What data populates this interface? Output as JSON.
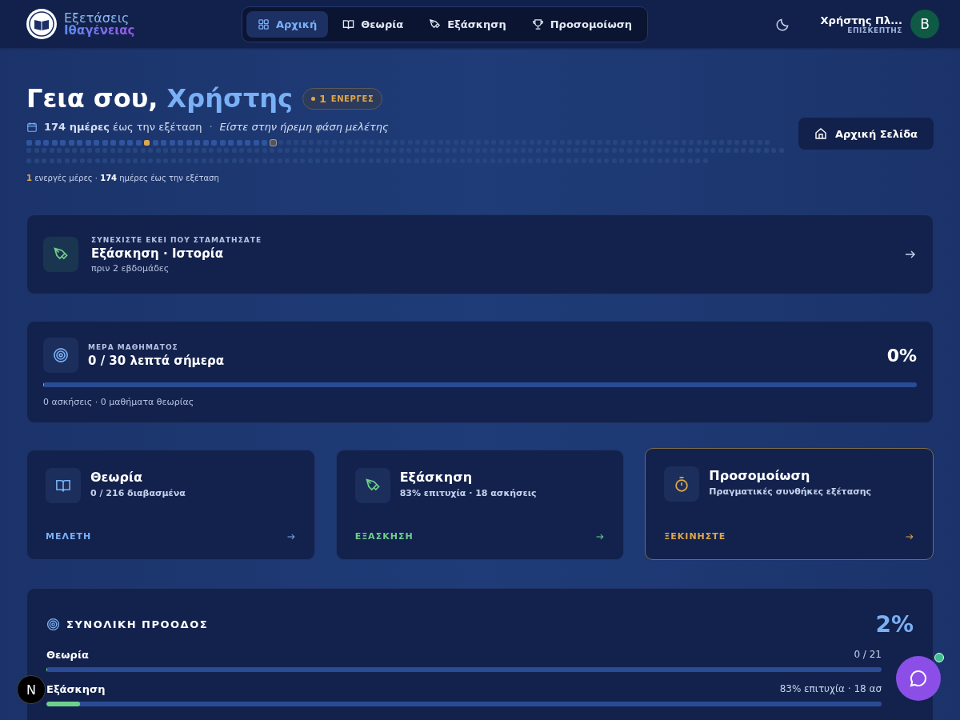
{
  "brand": {
    "line1": "Εξετάσεις",
    "line2": "Ιθαγένειας"
  },
  "nav": [
    {
      "label": "Αρχική",
      "selected": true
    },
    {
      "label": "Θεωρία",
      "selected": false
    },
    {
      "label": "Εξάσκηση",
      "selected": false
    },
    {
      "label": "Προσομοίωση",
      "selected": false
    }
  ],
  "user": {
    "name": "Χρήστης Πλ...",
    "role": "ΕΠΙΣΚΕΠΤΗΣ",
    "initial": "B"
  },
  "greeting": {
    "hello": "Γεια σου,",
    "name": "Χρήστης",
    "badge_count": "1",
    "badge_label": "ΕΝΕΡΓΕΣ",
    "countdown": "**174 ημέρες** έως την εξέταση",
    "separator": "·",
    "phase": "Είστε στην ήρεμη φάση μελέτης",
    "summary": "**1** ενεργές μέρες · **174** ημέρες έως την εξέταση"
  },
  "days": [
    {
      "kind": "past"
    },
    {
      "kind": "past"
    },
    {
      "kind": "past"
    },
    {
      "kind": "past"
    },
    {
      "kind": "past"
    },
    {
      "kind": "past"
    },
    {
      "kind": "past"
    },
    {
      "kind": "past"
    },
    {
      "kind": "past"
    },
    {
      "kind": "past"
    },
    {
      "kind": "past"
    },
    {
      "kind": "past"
    },
    {
      "kind": "past"
    },
    {
      "kind": "past"
    },
    {
      "kind": "active"
    },
    {
      "kind": "past"
    },
    {
      "kind": "past"
    },
    {
      "kind": "past"
    },
    {
      "kind": "past"
    },
    {
      "kind": "past"
    },
    {
      "kind": "past"
    },
    {
      "kind": "past"
    },
    {
      "kind": "past"
    },
    {
      "kind": "past"
    },
    {
      "kind": "past"
    },
    {
      "kind": "past"
    },
    {
      "kind": "past"
    },
    {
      "kind": "past"
    },
    {
      "kind": "past"
    },
    {
      "kind": "today"
    }
  ],
  "home_button": "Αρχική Σελίδα",
  "resume": {
    "label": "ΣΥΝΕΧΙΣΤΕ ΕΚΕΙ ΠΟΥ ΣΤΑΜΑΤΗΣΑΤΕ",
    "title": "Εξάσκηση · Ιστορία",
    "time": "πριν 2 εβδομάδες"
  },
  "daily": {
    "label": "ΜΕΡΑ ΜΑΘΗΜΑΤΟΣ",
    "title": "0 / 30 λεπτά σήμερα",
    "percent": "0%",
    "level": 0,
    "detail": "0 ασκήσεις · 0 μαθήματα θεωρίας"
  },
  "modes": [
    {
      "kind": "theory",
      "title": "Θεωρία",
      "subtitle": "0 / 216 διαβασμένα",
      "action": "ΜΕΛΕΤΗ",
      "color": "#7ab0f5",
      "highlighted": false
    },
    {
      "kind": "practice",
      "title": "Εξάσκηση",
      "subtitle": "83% επιτυχία · 18 ασκήσεις",
      "action": "ΕΞΑΣΚΗΣΗ",
      "color": "#6fd08c",
      "highlighted": false
    },
    {
      "kind": "exam",
      "title": "Προσομοίωση",
      "subtitle": "Πραγματικές συνθήκες εξέτασης",
      "action": "ΞΕΚΙΝΗΣΤΕ",
      "color": "#e0a84a",
      "highlighted": true
    }
  ],
  "progress": {
    "title": "ΣΥΝΟΛΙΚΗ ΠΡΟΟΔΟΣ",
    "percent": "2%",
    "rows": [
      {
        "label": "Θεωρία",
        "value": "0 / 21",
        "level": 0
      },
      {
        "label": "Εξάσκηση",
        "value": "83% επιτυχία · 18 ασ",
        "level": 0.04
      }
    ]
  },
  "floating": {
    "dev_badge": "N"
  }
}
